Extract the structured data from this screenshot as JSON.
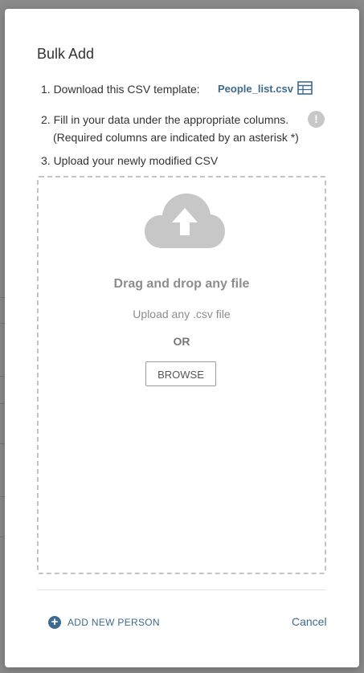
{
  "dialog": {
    "title": "Bulk Add"
  },
  "steps": {
    "step1_text": "1. Download this CSV template:",
    "csv_link": "People_list.csv",
    "step2_text": "2. Fill in your data under the appropriate columns.",
    "step2_sub": "(Required columns are indicated by an asterisk *)",
    "step3_text": "3. Upload your newly modified CSV"
  },
  "icons": {
    "table": "table-icon",
    "info": "info-icon",
    "info_glyph": "!",
    "cloud": "cloud-upload-icon",
    "plus": "plus-circle-icon",
    "plus_glyph": "+"
  },
  "dropzone": {
    "drag_text": "Drag and drop any file",
    "hint": "Upload any .csv file",
    "or_text": "OR",
    "browse_label": "BROWSE"
  },
  "footer": {
    "add_person_label": "ADD NEW PERSON",
    "cancel_label": "Cancel"
  },
  "colors": {
    "accent": "#3d6a8e",
    "overlay": "#8a8a8a",
    "muted_text": "#8d8d8d",
    "cloud": "#c7c7c7"
  }
}
